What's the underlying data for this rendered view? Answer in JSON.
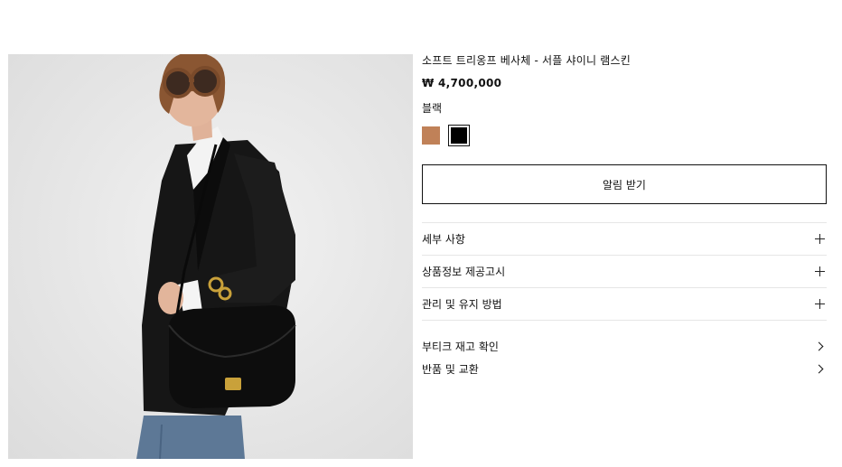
{
  "product": {
    "title": "소프트 트리옹프 베사체 - 서플 샤이니 램스킨",
    "price": "₩ 4,700,000",
    "color_label": "블랙",
    "colors": [
      {
        "name": "tan",
        "hex": "#c08158",
        "selected": false
      },
      {
        "name": "black",
        "hex": "#000000",
        "selected": true
      }
    ],
    "image_icon": "product-photo"
  },
  "actions": {
    "notify_label": "알림 받기"
  },
  "accordion": {
    "items": [
      {
        "label": "세부 사항",
        "icon": "plus-icon"
      },
      {
        "label": "상품정보 제공고시",
        "icon": "plus-icon"
      },
      {
        "label": "관리 및 유지 방법",
        "icon": "plus-icon"
      }
    ]
  },
  "links": {
    "items": [
      {
        "label": "부티크 재고 확인",
        "icon": "chevron-right-icon"
      },
      {
        "label": "반품 및 교환",
        "icon": "chevron-right-icon"
      }
    ]
  }
}
